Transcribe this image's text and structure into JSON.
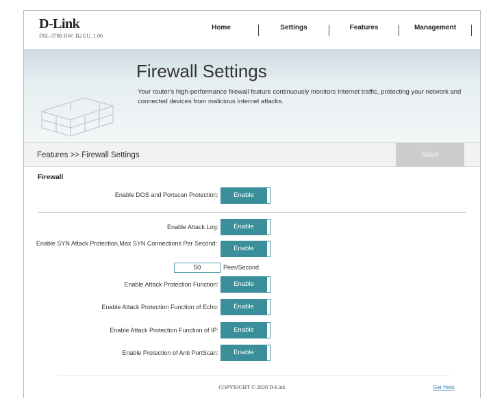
{
  "header": {
    "brand": "D-Link",
    "model_info": "DSL-3788  HW: B2  EU_1.00",
    "nav": [
      "Home",
      "Settings",
      "Features",
      "Management"
    ]
  },
  "banner": {
    "title": "Firewall Settings",
    "description": "Your router's high-performance firewall feature continuously monitors Internet traffic, protecting your network and connected devices from malicious Internet attacks."
  },
  "breadcrumb": "Features >> Firewall Settings",
  "save_label": "Save",
  "firewall": {
    "section_title": "Firewall",
    "rows": [
      {
        "label": "Enable DOS and Portscan Protection:",
        "value": "Enable"
      },
      {
        "label": "Enable Attack Log:",
        "value": "Enable"
      },
      {
        "label": "Enable SYN Attack Protection,Max SYN Connections Per Second:",
        "value": "Enable"
      },
      {
        "label": "Enable Attack Protection Function:",
        "value": "Enable"
      },
      {
        "label": "Enable Attack Protection Function of Echo:",
        "value": "Enable"
      },
      {
        "label": "Enable Attack Protection Function of IP:",
        "value": "Enable"
      },
      {
        "label": "Enable Protection of Anti PortScan:",
        "value": "Enable"
      }
    ],
    "syn_rate_value": "50",
    "syn_rate_unit": "Peer/Second"
  },
  "footer": {
    "copyright": "COPYRIGHT © 2020 D-Link",
    "help": "Get Help"
  }
}
